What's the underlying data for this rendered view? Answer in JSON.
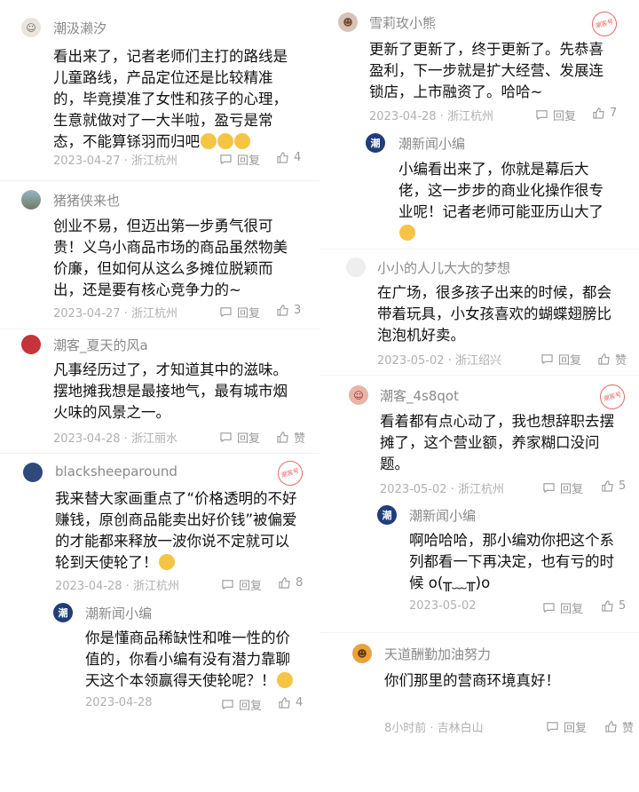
{
  "left": [
    {
      "user": "潮汲濑汐",
      "text": "看出来了，记者老师们主打的路线是儿童路线，产品定位还是比较精准的，毕竟摸准了女性和孩子的心理，生意就做对了一大半啦，盈亏是常态，不能算铩羽而归吧",
      "emoji_count": 3,
      "meta": "2023-04-27 · 浙江杭州",
      "reply": "回复",
      "likes": "4"
    },
    {
      "user": "猪猪侠来也",
      "text": "创业不易，但迈出第一步勇气很可贵！义乌小商品市场的商品虽然物美价廉，但如何从这么多摊位脱颖而出，还是要有核心竞争力的~",
      "meta": "2023-04-27 · 浙江杭州",
      "reply": "回复",
      "likes": "3"
    },
    {
      "user": "潮客_夏天的风a",
      "text": "凡事经历过了，才知道其中的滋味。摆地摊我想是最接地气，最有城市烟火味的风景之一。",
      "meta": "2023-04-28 · 浙江丽水",
      "reply": "回复",
      "likes": "赞"
    },
    {
      "user": "blacksheeparound",
      "text": "我来替大家画重点了“价格透明的不好赚钱，原创商品能卖出好价钱”被偏爱的才能都来释放一波你说不定就可以轮到天使轮了！",
      "stamp": "潮客号",
      "meta": "2023-04-28 · 浙江杭州",
      "reply": "回复",
      "likes": "8"
    },
    {
      "user": "潮新闻小编",
      "text": "你是懂商品稀缺性和唯一性的价值的，你看小编有没有潜力靠聊天这个本领赢得天使轮呢？！",
      "avatar": "潮",
      "meta": "2023-04-28",
      "reply": "回复",
      "likes": "4"
    }
  ],
  "right": [
    {
      "user": "雪莉玫小熊",
      "text": "更新了更新了，终于更新了。先恭喜盈利，下一步就是扩大经营、发展连锁店，上市融资了。哈哈~",
      "stamp": "潮客号",
      "meta": "2023-04-28 · 浙江杭州",
      "reply": "回复",
      "likes": "7"
    },
    {
      "user": "潮新闻小编",
      "text": "小编看出来了，你就是幕后大佬，这一步步的商业化操作很专业呢！记者老师可能亚历山大了",
      "avatar": "潮"
    },
    {
      "user": "小小的人儿大大的梦想",
      "text": "在广场，很多孩子出来的时候，都会带着玩具，小女孩喜欢的蝴蝶翅膀比泡泡机好卖。",
      "meta": "2023-05-02 · 浙江绍兴",
      "reply": "回复",
      "likes": "赞"
    },
    {
      "user": "潮客_4s8qot",
      "text": "看着都有点心动了，我也想辞职去摆摊了，这个营业额，养家糊口没问题。",
      "stamp": "潮客号",
      "meta": "2023-05-02 · 浙江杭州",
      "reply": "回复",
      "likes": "5"
    },
    {
      "user": "潮新闻小编",
      "text": "啊哈哈哈，那小编劝你把这个系列都看一下再决定，也有亏的时候 o(╥﹏╥)o",
      "avatar": "潮",
      "meta": "2023-05-02",
      "reply": "回复",
      "likes": "5"
    },
    {
      "user": "天道酬勤加油努力",
      "text": "你们那里的营商环境真好！",
      "meta": "8小时前 · 吉林白山",
      "reply": "回复",
      "likes": "赞"
    }
  ]
}
